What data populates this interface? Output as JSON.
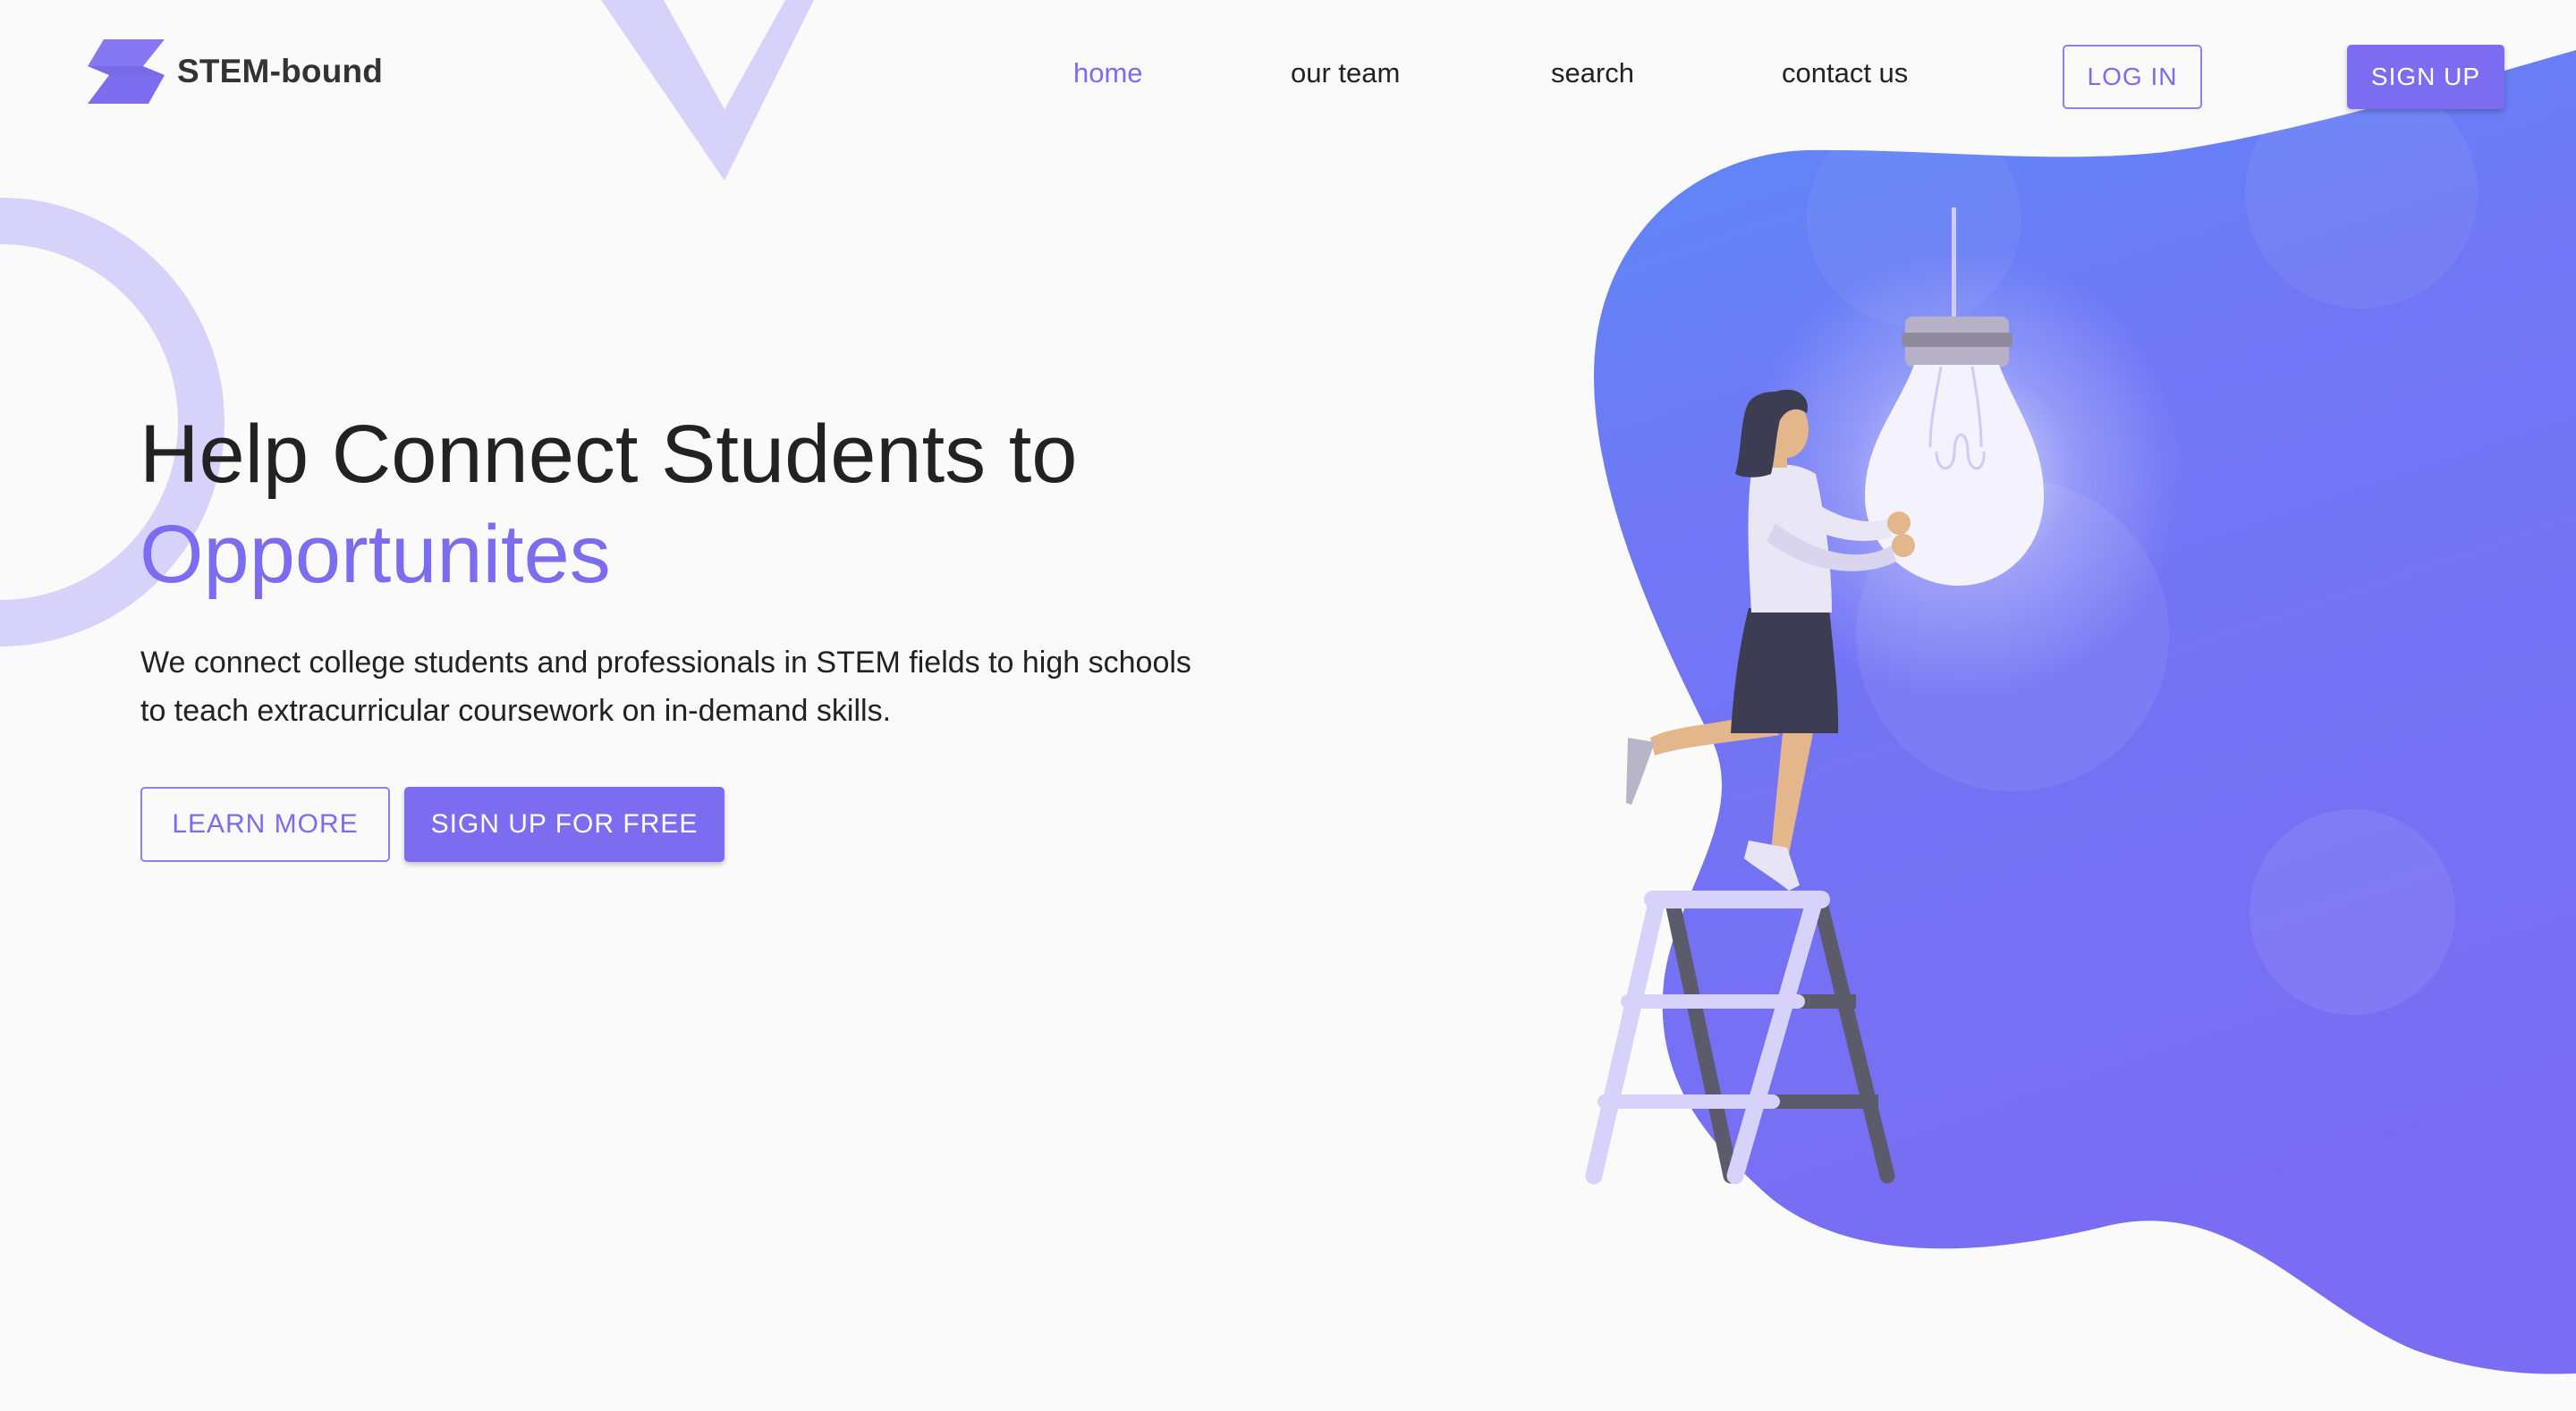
{
  "brand": {
    "name": "STEM-bound",
    "logo_icon": "stem-bound-logo-icon"
  },
  "nav": {
    "home": "home",
    "our_team": "our team",
    "search": "search",
    "contact_us": "contact us",
    "log_in": "LOG IN",
    "sign_up": "SIGN UP"
  },
  "hero": {
    "title_line1": "Help Connect Students to",
    "title_line2": "Opportunites",
    "description_line1": "We connect college students and professionals in STEM fields to high schools",
    "description_line2": "to teach extracurricular coursework on in-demand skills.",
    "learn_more": "LEARN MORE",
    "sign_up_free": "SIGN UP FOR FREE"
  },
  "colors": {
    "accent": "#7b6cf0",
    "accent_light": "#d7d2fa",
    "blob_top": "#5b8bf7",
    "blob_bottom": "#7a6cf3",
    "text": "#222222",
    "background": "#fafafa"
  },
  "illustration": "woman-on-ladder-holding-light-bulb"
}
